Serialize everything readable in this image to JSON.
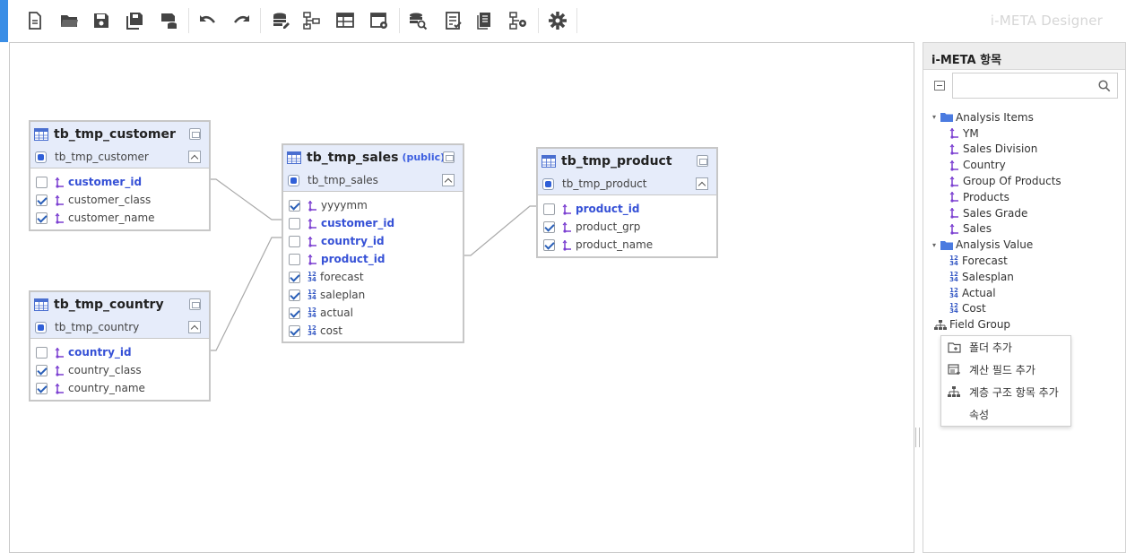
{
  "app": {
    "title": "i-META Designer"
  },
  "toolbar": {
    "buttons": [
      {
        "icon": "new-file-icon"
      },
      {
        "icon": "open-folder-icon"
      },
      {
        "icon": "save-icon"
      },
      {
        "icon": "save-as-icon"
      },
      {
        "icon": "save-db-icon"
      },
      {
        "icon": "undo-icon"
      },
      {
        "icon": "redo-icon"
      },
      {
        "icon": "database-edit-icon"
      },
      {
        "icon": "tree-structure-icon"
      },
      {
        "icon": "table-edit-icon"
      },
      {
        "icon": "table-settings-icon"
      },
      {
        "icon": "query-search-icon"
      },
      {
        "icon": "checklist-icon"
      },
      {
        "icon": "document-icon"
      },
      {
        "icon": "hierarchy-settings-icon"
      },
      {
        "icon": "settings-gear-icon"
      }
    ]
  },
  "tables": {
    "customer": {
      "name": "tb_tmp_customer",
      "sub": "tb_tmp_customer",
      "fields": [
        {
          "name": "customer_id",
          "checked": false,
          "key": true
        },
        {
          "name": "customer_class",
          "checked": true,
          "key": false
        },
        {
          "name": "customer_name",
          "checked": true,
          "key": false
        }
      ]
    },
    "country": {
      "name": "tb_tmp_country",
      "sub": "tb_tmp_country",
      "fields": [
        {
          "name": "country_id",
          "checked": false,
          "key": true
        },
        {
          "name": "country_class",
          "checked": true,
          "key": false
        },
        {
          "name": "country_name",
          "checked": true,
          "key": false
        }
      ]
    },
    "sales": {
      "name": "tb_tmp_sales",
      "schema": "(public)",
      "sub": "tb_tmp_sales",
      "fields": [
        {
          "name": "yyyymm",
          "checked": true,
          "key": false,
          "type": "dim"
        },
        {
          "name": "customer_id",
          "checked": false,
          "key": true,
          "type": "dim"
        },
        {
          "name": "country_id",
          "checked": false,
          "key": true,
          "type": "dim"
        },
        {
          "name": "product_id",
          "checked": false,
          "key": true,
          "type": "dim"
        },
        {
          "name": "forecast",
          "checked": true,
          "key": false,
          "type": "num"
        },
        {
          "name": "saleplan",
          "checked": true,
          "key": false,
          "type": "num"
        },
        {
          "name": "actual",
          "checked": true,
          "key": false,
          "type": "num"
        },
        {
          "name": "cost",
          "checked": true,
          "key": false,
          "type": "num"
        }
      ]
    },
    "product": {
      "name": "tb_tmp_product",
      "sub": "tb_tmp_product",
      "fields": [
        {
          "name": "product_id",
          "checked": false,
          "key": true
        },
        {
          "name": "product_grp",
          "checked": true,
          "key": false
        },
        {
          "name": "product_name",
          "checked": true,
          "key": false
        }
      ]
    }
  },
  "panel": {
    "title": "i-META 항목",
    "search_placeholder": "",
    "tree": {
      "analysis_items": {
        "label": "Analysis Items",
        "children": [
          "YM",
          "Sales Division",
          "Country",
          "Group Of Products",
          "Products",
          "Sales Grade",
          "Sales"
        ]
      },
      "analysis_value": {
        "label": "Analysis Value",
        "children": [
          "Forecast",
          "Salesplan",
          "Actual",
          "Cost"
        ]
      },
      "field_group": {
        "label": "Field Group"
      }
    },
    "context_menu": [
      "폴더 추가",
      "계산 필드 추가",
      "계층 구조 항목 추가",
      "속성"
    ]
  },
  "num_glyph_top": "12",
  "num_glyph_bottom": "34",
  "colors": {
    "accent": "#3a8ee6",
    "key_field": "#3651d6",
    "header_bg": "#e6ecfa",
    "link_icon": "#7b3fd1"
  }
}
